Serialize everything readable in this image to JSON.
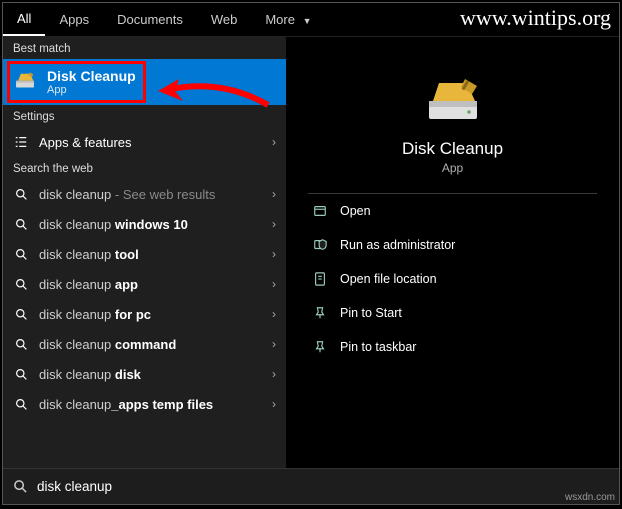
{
  "watermark": "www.wintips.org",
  "wsxdn": "wsxdn.com",
  "tabs": {
    "all": "All",
    "apps": "Apps",
    "documents": "Documents",
    "web": "Web",
    "more": "More"
  },
  "sections": {
    "best_match": "Best match",
    "settings": "Settings",
    "search_web": "Search the web"
  },
  "best_match": {
    "title": "Disk Cleanup",
    "subtitle": "App"
  },
  "settings": {
    "apps_features": "Apps & features"
  },
  "web": {
    "base": "disk cleanup",
    "see_results": " - See web results",
    "s1_prefix": "disk cleanup ",
    "s1_bold": "windows 10",
    "s2_prefix": "disk cleanup ",
    "s2_bold": "tool",
    "s3_prefix": "disk cleanup ",
    "s3_bold": "app",
    "s4_prefix": "disk cleanup ",
    "s4_bold": "for pc",
    "s5_prefix": "disk cleanup ",
    "s5_bold": "command",
    "s6_prefix": "disk cleanup ",
    "s6_bold": "disk",
    "s7_prefix": "disk cleanup",
    "s7_bold": "_apps temp files"
  },
  "detail": {
    "title": "Disk Cleanup",
    "subtitle": "App"
  },
  "actions": {
    "open": "Open",
    "run_admin": "Run as administrator",
    "open_location": "Open file location",
    "pin_start": "Pin to Start",
    "pin_taskbar": "Pin to taskbar"
  },
  "search": {
    "value": "disk cleanup"
  }
}
